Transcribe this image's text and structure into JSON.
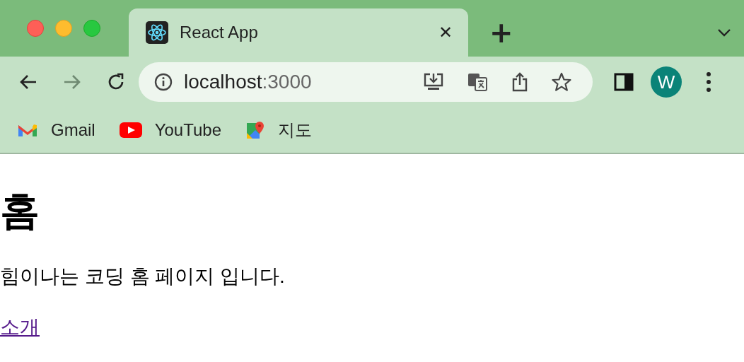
{
  "tab": {
    "title": "React App",
    "close": "✕",
    "new_tab": "+"
  },
  "address": {
    "host": "localhost",
    "port": ":3000"
  },
  "profile": {
    "initial": "W"
  },
  "bookmarks": [
    {
      "label": "Gmail",
      "kind": "gmail"
    },
    {
      "label": "YouTube",
      "kind": "youtube"
    },
    {
      "label": "지도",
      "kind": "maps"
    }
  ],
  "page": {
    "heading": "홈",
    "text": "힘이나는 코딩 홈 페이지 입니다.",
    "link": "소개"
  }
}
